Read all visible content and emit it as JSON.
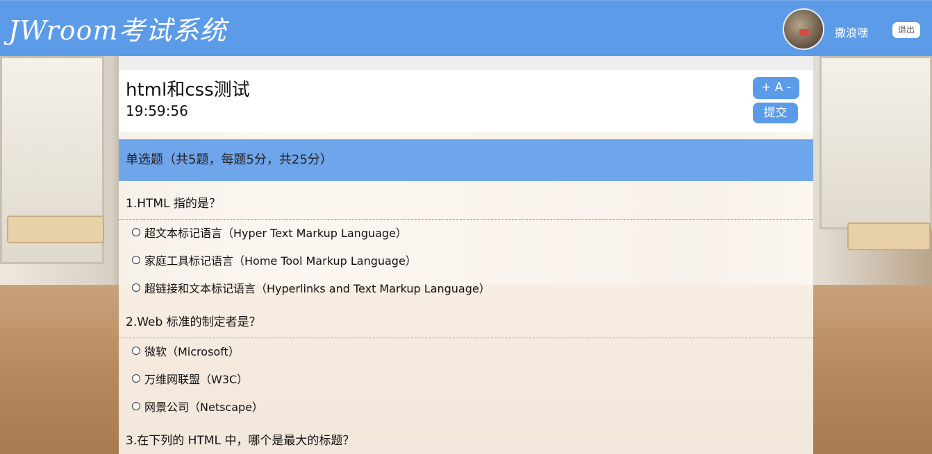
{
  "header": {
    "logo": "JWroom考试系统",
    "username": "撒浪嘿",
    "logout_label": "退出"
  },
  "exam": {
    "title": "html和css测试",
    "timer": "19:59:56",
    "font_control_label": "+ A -",
    "submit_label": "提交"
  },
  "section": {
    "title": "单选题（共5题，每题5分，共25分）"
  },
  "questions": [
    {
      "text": "1.HTML 指的是？",
      "options": [
        "超文本标记语言（Hyper Text Markup Language）",
        "家庭工具标记语言（Home Tool Markup Language）",
        "超链接和文本标记语言（Hyperlinks and Text Markup Language）"
      ]
    },
    {
      "text": "2.Web 标准的制定者是？",
      "options": [
        "微软（Microsoft）",
        "万维网联盟（W3C）",
        "网景公司（Netscape）"
      ]
    },
    {
      "text": "3.在下列的 HTML 中，哪个是最大的标题？",
      "options": []
    }
  ],
  "colors": {
    "accent": "#5b9be8",
    "section_bg": "#6fa5ea"
  }
}
